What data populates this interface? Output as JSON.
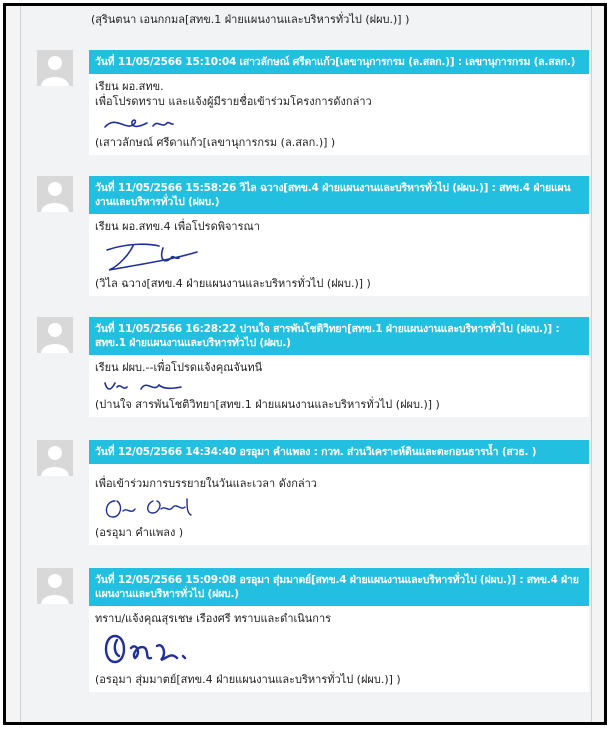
{
  "top_footer": "(สุรินตนา เอนกกมล[สทข.1 ฝ่ายแผนงานและบริหารทั่วไป (ฝผบ.)] )",
  "entries": [
    {
      "header": "วันที่ 11/05/2566 15:10:04 เสาวลักษณ์ ศรีดาแก้ว[เลขานุการกรม (ล.สลก.)] : เลขานุการกรม (ล.สลก.)",
      "lines": [
        "เรียน ผอ.สทข.",
        "เพื่อโปรดทราบ และแจ้งผู้มีรายชื่อเข้าร่วมโครงการดังกล่าว"
      ],
      "footer": "(เสาวลักษณ์ ศรีดาแก้ว[เลขานุการกรม (ล.สลก.)] )"
    },
    {
      "header": "วันที่ 11/05/2566 15:58:26 วิไล ฉวาง[สทข.4 ฝ่ายแผนงานและบริหารทั่วไป (ฝผบ.)] : สทข.4 ฝ่ายแผนงานและบริหารทั่วไป (ฝผบ.)",
      "lines": [
        "เรียน ผอ.สทข.4 เพื่อโปรดพิจารณา"
      ],
      "footer": "(วิไล ฉวาง[สทข.4 ฝ่ายแผนงานและบริหารทั่วไป (ฝผบ.)] )"
    },
    {
      "header": "วันที่ 11/05/2566 16:28:22 ปานใจ สารพันโชติวิทยา[สทข.1 ฝ่ายแผนงานและบริหารทั่วไป (ฝผบ.)] : สทข.1 ฝ่ายแผนงานและบริหารทั่วไป (ฝผบ.)",
      "lines": [
        "เรียน ฝผบ.--เพื่อโปรดแจ้งคุณจันทนี"
      ],
      "footer": "(ปานใจ สารพันโชติวิทยา[สทข.1 ฝ่ายแผนงานและบริหารทั่วไป (ฝผบ.)] )"
    },
    {
      "header": "วันที่ 12/05/2566 14:34:40 อรอุมา คำแพลง : กวท. ส่วนวิเคราะห์ดินและตะกอนธารน้ำ (สวธ. )",
      "lines": [
        "เพื่อเข้าร่วมการบรรยายในวันและเวลา ดังกล่าว"
      ],
      "footer": "(อรอุมา คำแพลง )"
    },
    {
      "header": "วันที่ 12/05/2566 15:09:08 อรอุมา สุ่มมาตย์[สทข.4 ฝ่ายแผนงานและบริหารทั่วไป (ฝผบ.)] : สทข.4 ฝ่ายแผนงานและบริหารทั่วไป (ฝผบ.)",
      "lines": [
        "ทราบ/แจ้งคุณสุรเชษ เรืองศรี ทราบและดำเนินการ"
      ],
      "footer": "(อรอุมา สุ่มมาตย์[สทข.4 ฝ่ายแผนงานและบริหารทั่วไป (ฝผบ.)] )"
    }
  ],
  "colors": {
    "header_bg": "#22bfe0",
    "signature": "#1f2f9c"
  },
  "icons": {
    "avatar": "user-avatar-icon"
  }
}
